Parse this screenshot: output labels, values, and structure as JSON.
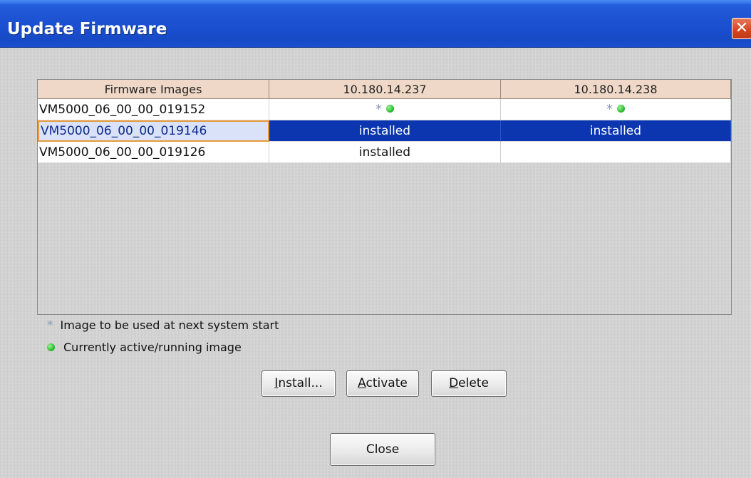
{
  "window": {
    "title": "Update Firmware",
    "close_glyph": "✕"
  },
  "table": {
    "columns": [
      "Firmware Images",
      "10.180.14.237",
      "10.180.14.238"
    ],
    "rows": [
      {
        "image": "VM5000_06_00_00_019152",
        "col1": "",
        "col2": "",
        "col1_icons": [
          "next-start-star-icon",
          "active-dot-icon"
        ],
        "col2_icons": [
          "next-start-star-icon",
          "active-dot-icon"
        ]
      },
      {
        "image": "VM5000_06_00_00_019146",
        "col1": "installed",
        "col2": "installed",
        "selected": true
      },
      {
        "image": "VM5000_06_00_00_019126",
        "col1": "installed",
        "col2": ""
      }
    ]
  },
  "legend": {
    "star_label": "Image to be used at next system start",
    "dot_label": "Currently active/running image",
    "star_glyph": "*"
  },
  "buttons": {
    "install": {
      "mnemonic": "I",
      "rest": "nstall..."
    },
    "activate": {
      "mnemonic": "A",
      "rest": "ctivate"
    },
    "delete": {
      "mnemonic": "D",
      "rest": "elete"
    },
    "close": "Close"
  },
  "colors": {
    "titlebar": "#1f56d6",
    "header_bg": "#efd8c7",
    "selection": "#0b36b0",
    "focus_border": "#e49a3b",
    "active_dot": "#2fbf2f"
  }
}
